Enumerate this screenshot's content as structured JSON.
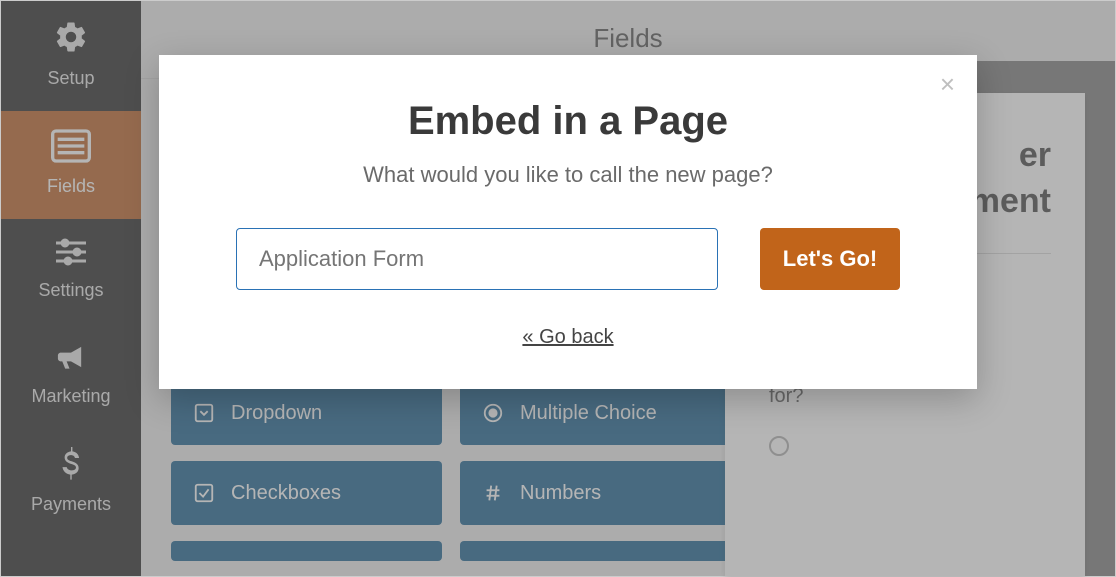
{
  "sidebar": {
    "items": [
      {
        "key": "setup",
        "label": "Setup",
        "active": false
      },
      {
        "key": "fields",
        "label": "Fields",
        "active": true
      },
      {
        "key": "settings",
        "label": "Settings",
        "active": false
      },
      {
        "key": "marketing",
        "label": "Marketing",
        "active": false
      },
      {
        "key": "payments",
        "label": "Payments",
        "active": false
      }
    ]
  },
  "header": {
    "title": "Fields"
  },
  "fields_visible": [
    {
      "key": "dropdown",
      "label": "Dropdown"
    },
    {
      "key": "multiple_choice",
      "label": "Multiple Choice"
    },
    {
      "key": "checkboxes",
      "label": "Checkboxes"
    },
    {
      "key": "numbers",
      "label": "Numbers"
    }
  ],
  "preview": {
    "title_line1": "er",
    "title_line2": "ment",
    "question": "Which programs are you interested in volunteering for?"
  },
  "modal": {
    "title": "Embed in a Page",
    "subtitle": "What would you like to call the new page?",
    "placeholder": "Application Form",
    "value": "",
    "button": "Let's Go!",
    "back": "« Go back",
    "close_label": "×"
  },
  "colors": {
    "sidebar_bg": "#1b1b1b",
    "sidebar_active": "#b85a1b",
    "field_chip": "#0e5a8a",
    "primary_button": "#c1641a",
    "input_border": "#2a72b5"
  }
}
